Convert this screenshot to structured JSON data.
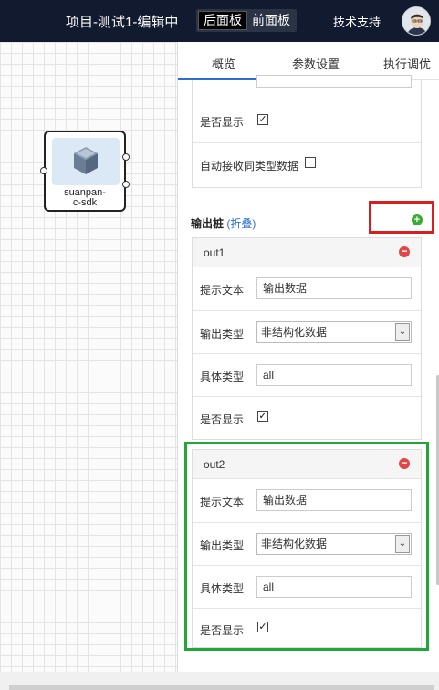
{
  "header": {
    "title": "项目-测试1-编辑中",
    "backend_label": "后面板",
    "frontend_label": "前面板",
    "support_label": "技术支持"
  },
  "node": {
    "label_line1": "suanpan-",
    "label_line2": "c-sdk"
  },
  "tabs": [
    "概览",
    "参数设置",
    "执行调优"
  ],
  "top_box": {
    "show_label": "是否显示",
    "show_checked": true,
    "auto_receive_label": "自动接收同类型数据",
    "auto_receive_checked": false
  },
  "output_section": {
    "title": "输出桩",
    "fold_label": "(折叠)"
  },
  "outputs": [
    {
      "name": "out1",
      "hint_label": "提示文本",
      "hint_value": "输出数据",
      "type_label": "输出类型",
      "type_value": "非结构化数据",
      "specific_label": "具体类型",
      "specific_value": "all",
      "show_label": "是否显示",
      "show_checked": true
    },
    {
      "name": "out2",
      "hint_label": "提示文本",
      "hint_value": "输出数据",
      "type_label": "输出类型",
      "type_value": "非结构化数据",
      "specific_label": "具体类型",
      "specific_value": "all",
      "show_label": "是否显示",
      "show_checked": true
    }
  ],
  "colors": {
    "header_bg": "#111a2e",
    "accent": "#2c6fd1",
    "add": "#3aaa35",
    "remove": "#e04848",
    "highlight_red": "#d62020",
    "highlight_green": "#22a63a"
  }
}
